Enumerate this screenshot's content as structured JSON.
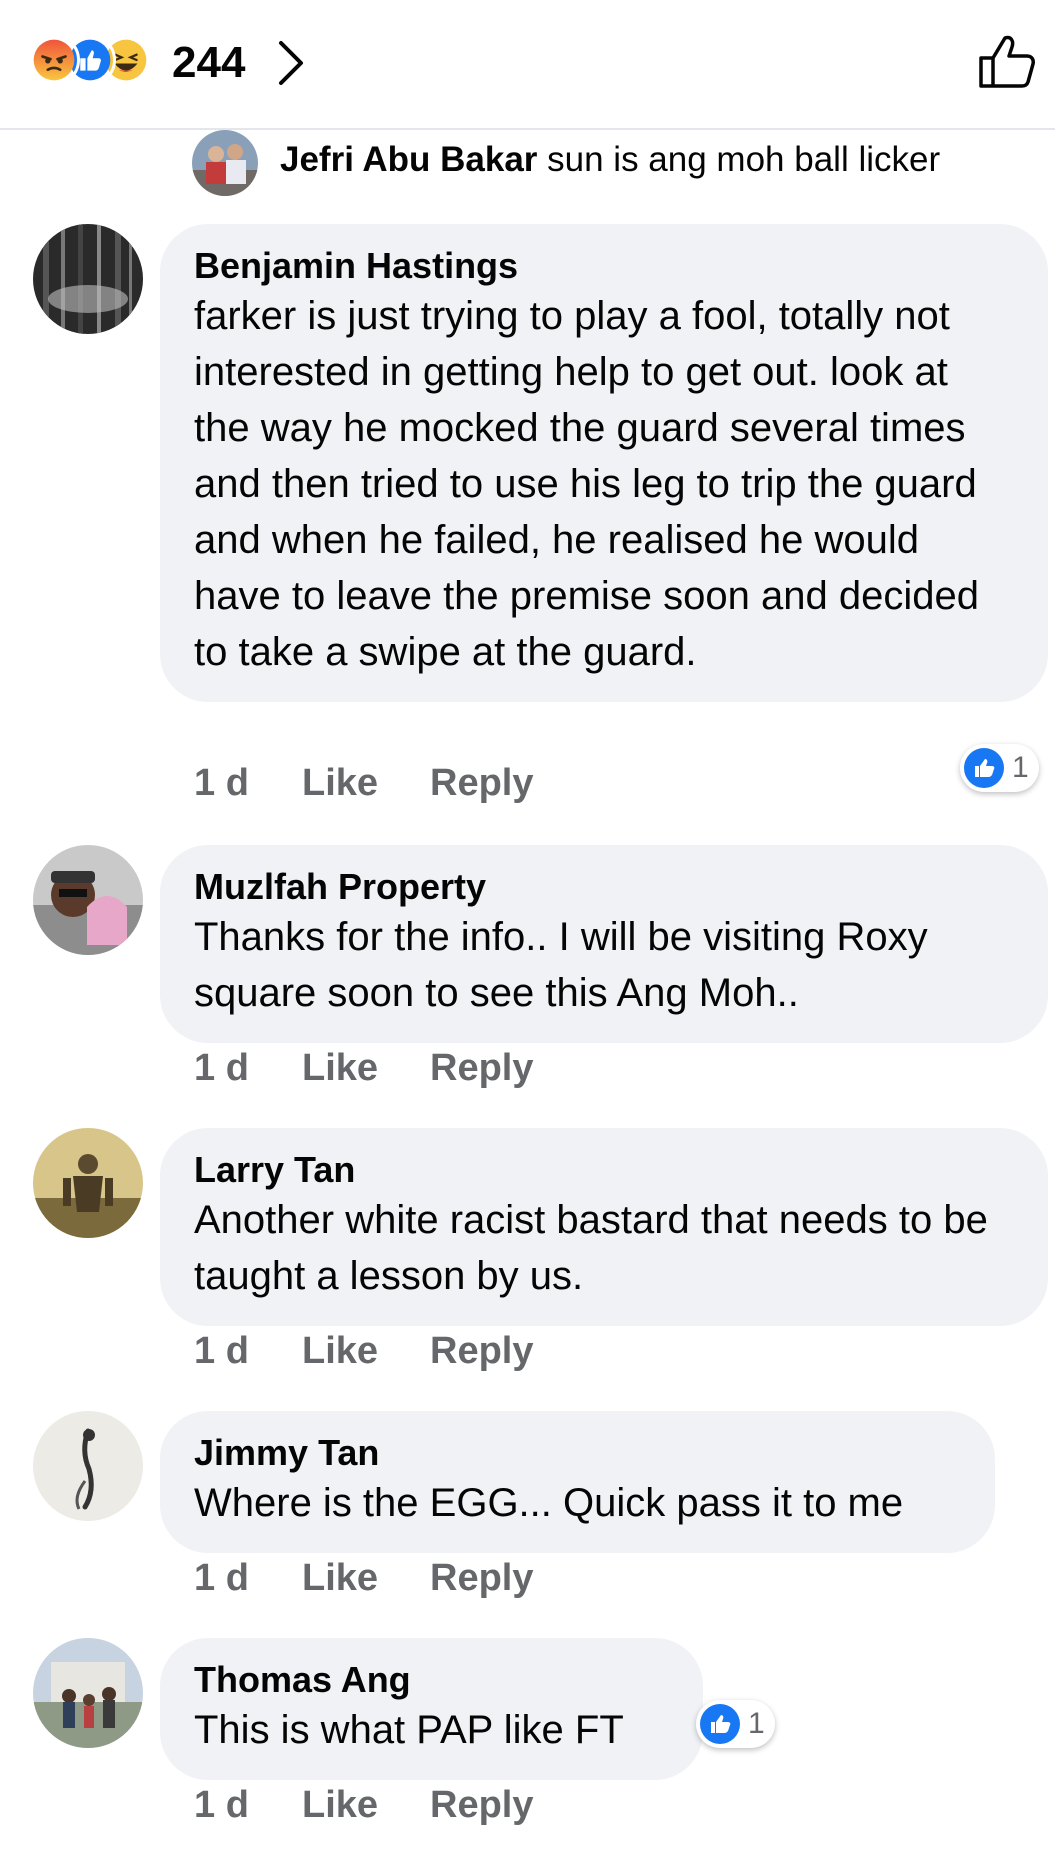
{
  "header": {
    "reaction_icons": [
      "angry-face-icon",
      "like-thumb-icon",
      "laugh-face-icon"
    ],
    "reaction_count": "244"
  },
  "reply_preview": {
    "author": "Jefri Abu Bakar",
    "text": "sun is ang moh ball licker"
  },
  "comments": [
    {
      "author": "Benjamin Hastings",
      "text": "farker is just trying to play a fool, totally not interested in getting help to get out. look at the way he mocked the guard several times and then tried to use his leg to trip the guard and when he failed, he realised he would have to leave the premise soon and decided to take a swipe at the guard.",
      "time": "1 d",
      "like": "Like",
      "reply": "Reply",
      "likes": "1"
    },
    {
      "author": "Muzlfah Property",
      "text": "Thanks for the info.. I will be visiting Roxy square soon to see this Ang Moh..",
      "time": "1 d",
      "like": "Like",
      "reply": "Reply"
    },
    {
      "author": "Larry Tan",
      "text": "Another white racist bastard that needs to be taught a lesson by us.",
      "time": "1 d",
      "like": "Like",
      "reply": "Reply"
    },
    {
      "author": "Jimmy Tan",
      "text": "Where is the EGG... Quick pass it to me",
      "time": "1 d",
      "like": "Like",
      "reply": "Reply"
    },
    {
      "author": "Thomas Ang",
      "text": "This is what PAP like FT",
      "time": "1 d",
      "like": "Like",
      "reply": "Reply",
      "likes": "1"
    }
  ],
  "colors": {
    "bubble": "#f0f2f5",
    "secondary_text": "#65676b",
    "like_blue": "#1877f2"
  }
}
